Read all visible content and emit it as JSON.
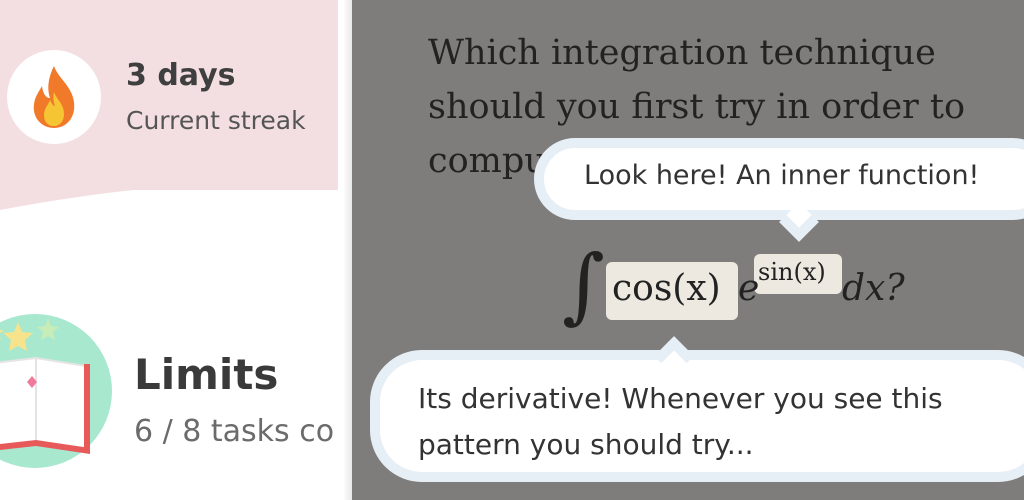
{
  "streak": {
    "title": "3 days",
    "subtitle": "Current streak",
    "icon": "flame-icon"
  },
  "course": {
    "title": "Limits",
    "progress_text": "6 / 8 tasks co",
    "tasks_done": 6,
    "tasks_total": 8,
    "icon": "book-icon"
  },
  "question": {
    "text": "Which integration technique should you first try in order to compu"
  },
  "formula": {
    "integral": "∫",
    "inner": "cos(x)",
    "base": "e",
    "exponent": "sin(x)",
    "tail": "dx?"
  },
  "hints": {
    "top": "Look here! An inner function!",
    "bottom": "Its derivative! Whenever you see this pattern you should try..."
  },
  "colors": {
    "streak_card": "#f3dfe1",
    "book_circle": "#a7e8cf",
    "overlay": "#7e7d7b",
    "highlight": "#ede9e1",
    "bubble_border": "#e6eef6",
    "flame": "#f07a2a"
  }
}
